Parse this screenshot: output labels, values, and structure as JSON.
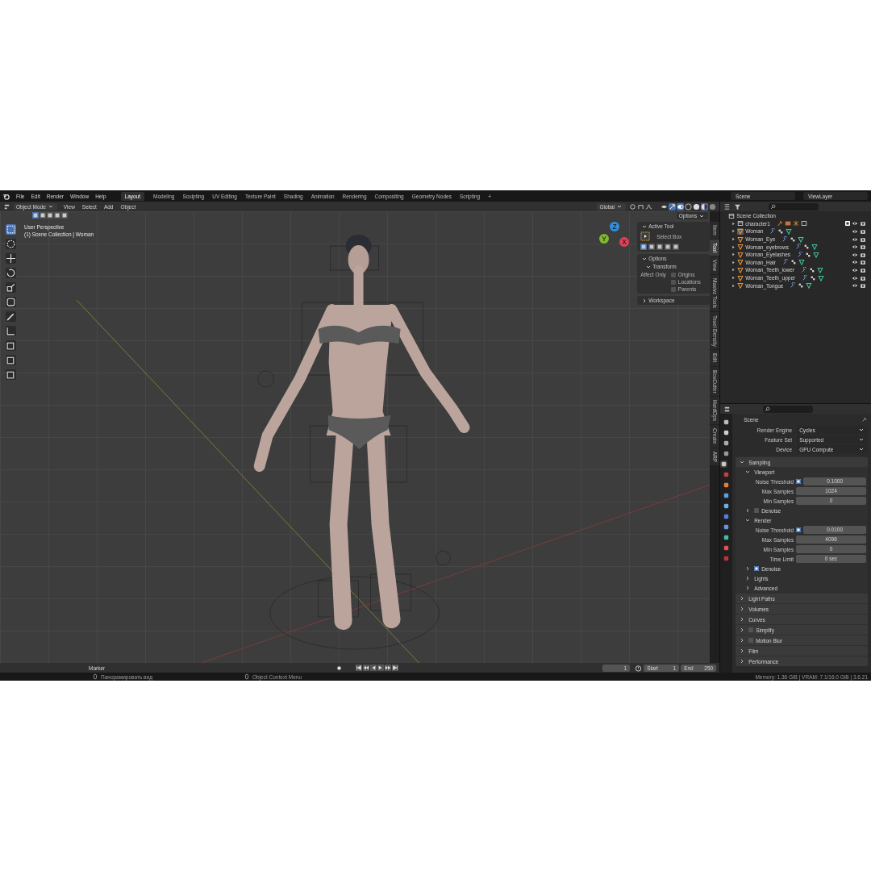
{
  "menu": [
    "File",
    "Edit",
    "Render",
    "Window",
    "Help"
  ],
  "workspaces": [
    {
      "label": "Layout",
      "selected": true
    },
    {
      "label": "Modeling",
      "selected": false
    },
    {
      "label": "Sculpting",
      "selected": false
    },
    {
      "label": "UV Editing",
      "selected": false
    },
    {
      "label": "Texture Paint",
      "selected": false
    },
    {
      "label": "Shading",
      "selected": false
    },
    {
      "label": "Animation",
      "selected": false
    },
    {
      "label": "Rendering",
      "selected": false
    },
    {
      "label": "Compositing",
      "selected": false
    },
    {
      "label": "Geometry Nodes",
      "selected": false
    },
    {
      "label": "Scripting",
      "selected": false
    }
  ],
  "add_workspace": "+",
  "scene_field": "Scene",
  "view_layer_field": "ViewLayer",
  "viewport_header": {
    "mode": "Object Mode",
    "menus": [
      "View",
      "Select",
      "Add",
      "Object"
    ],
    "orientation": "Global",
    "options": "Options"
  },
  "viewport": {
    "overlay_lines": [
      "User Perspective",
      "(1) Scene Collection | Woman"
    ],
    "gizmo_axes": [
      "X",
      "Y",
      "Z"
    ]
  },
  "tool_panel": {
    "active_tool": "Active Tool",
    "tool_name": "Select Box",
    "options": "Options",
    "transform": "Transform",
    "affect_only": "Affect Only",
    "checkboxes": [
      {
        "label": "Origins",
        "checked": false
      },
      {
        "label": "Locations",
        "checked": false
      },
      {
        "label": "Parents",
        "checked": false
      }
    ],
    "workspace": "Workspace"
  },
  "sidebar_tabs": [
    {
      "label": "Item",
      "selected": false
    },
    {
      "label": "Tool",
      "selected": true
    },
    {
      "label": "View",
      "selected": false
    },
    {
      "label": "Maxivz Tools",
      "selected": false
    },
    {
      "label": "Texel Density",
      "selected": false
    },
    {
      "label": "Edit",
      "selected": false
    },
    {
      "label": "BoxCutter",
      "selected": false
    },
    {
      "label": "HardOps",
      "selected": false
    },
    {
      "label": "Create",
      "selected": false
    },
    {
      "label": "ARP",
      "selected": false
    }
  ],
  "outliner": {
    "root": "Scene Collection",
    "items": [
      {
        "name": "character1",
        "kind": "collection",
        "selected": false,
        "checked": true
      },
      {
        "name": "Woman",
        "kind": "mesh",
        "selected": true
      },
      {
        "name": "Woman_Eye",
        "kind": "mesh",
        "selected": false
      },
      {
        "name": "Woman_eyebrows",
        "kind": "mesh",
        "selected": false
      },
      {
        "name": "Woman_Eyelashes",
        "kind": "mesh",
        "selected": false
      },
      {
        "name": "Woman_Hair",
        "kind": "mesh",
        "selected": false
      },
      {
        "name": "Woman_Teeth_lower",
        "kind": "mesh",
        "selected": false
      },
      {
        "name": "Woman_Teeth_upper",
        "kind": "mesh",
        "selected": false
      },
      {
        "name": "Woman_Tongue",
        "kind": "mesh",
        "selected": false
      }
    ]
  },
  "properties": {
    "title": "Scene",
    "settings": [
      {
        "label": "Render Engine",
        "value": "Cycles"
      },
      {
        "label": "Feature Set",
        "value": "Supported"
      },
      {
        "label": "Device",
        "value": "GPU Compute"
      }
    ],
    "rows": [
      {
        "kind": "panel",
        "label": "Sampling",
        "expanded": true
      },
      {
        "kind": "subpanel",
        "label": "Viewport",
        "expanded": true
      },
      {
        "kind": "field",
        "label": "Noise Threshold",
        "value": "0.1000",
        "checked": true
      },
      {
        "kind": "field",
        "label": "Max Samples",
        "value": "1024"
      },
      {
        "kind": "field",
        "label": "Min Samples",
        "value": "0"
      },
      {
        "kind": "subpanel",
        "label": "Denoise",
        "expanded": false,
        "checked": false
      },
      {
        "kind": "subpanel",
        "label": "Render",
        "expanded": true
      },
      {
        "kind": "field",
        "label": "Noise Threshold",
        "value": "0.0100",
        "checked": true
      },
      {
        "kind": "field",
        "label": "Max Samples",
        "value": "4096"
      },
      {
        "kind": "field",
        "label": "Min Samples",
        "value": "0"
      },
      {
        "kind": "field",
        "label": "Time Limit",
        "value": "0 sec"
      },
      {
        "kind": "subpanel",
        "label": "Denoise",
        "expanded": false,
        "checked": true
      },
      {
        "kind": "subpanel",
        "label": "Lights",
        "expanded": false
      },
      {
        "kind": "subpanel",
        "label": "Advanced",
        "expanded": false
      },
      {
        "kind": "panel",
        "label": "Light Paths",
        "expanded": false
      },
      {
        "kind": "panel",
        "label": "Volumes",
        "expanded": false
      },
      {
        "kind": "panel",
        "label": "Curves",
        "expanded": false
      },
      {
        "kind": "panel",
        "label": "Simplify",
        "expanded": false,
        "checked": false
      },
      {
        "kind": "panel",
        "label": "Motion Blur",
        "expanded": false,
        "checked": false
      },
      {
        "kind": "panel",
        "label": "Film",
        "expanded": false
      },
      {
        "kind": "panel",
        "label": "Performance",
        "expanded": false
      }
    ]
  },
  "timeline": {
    "marker": "Marker",
    "current_frame": "1",
    "start_label": "Start",
    "start": "1",
    "end_label": "End",
    "end": "250"
  },
  "status_bar": {
    "hints": [
      "Панорамировать вид",
      "Object Context Menu"
    ],
    "info": "Memory: 1.36 GiB | VRAM: 7.1/16.0 GiB | 3.6.21"
  }
}
